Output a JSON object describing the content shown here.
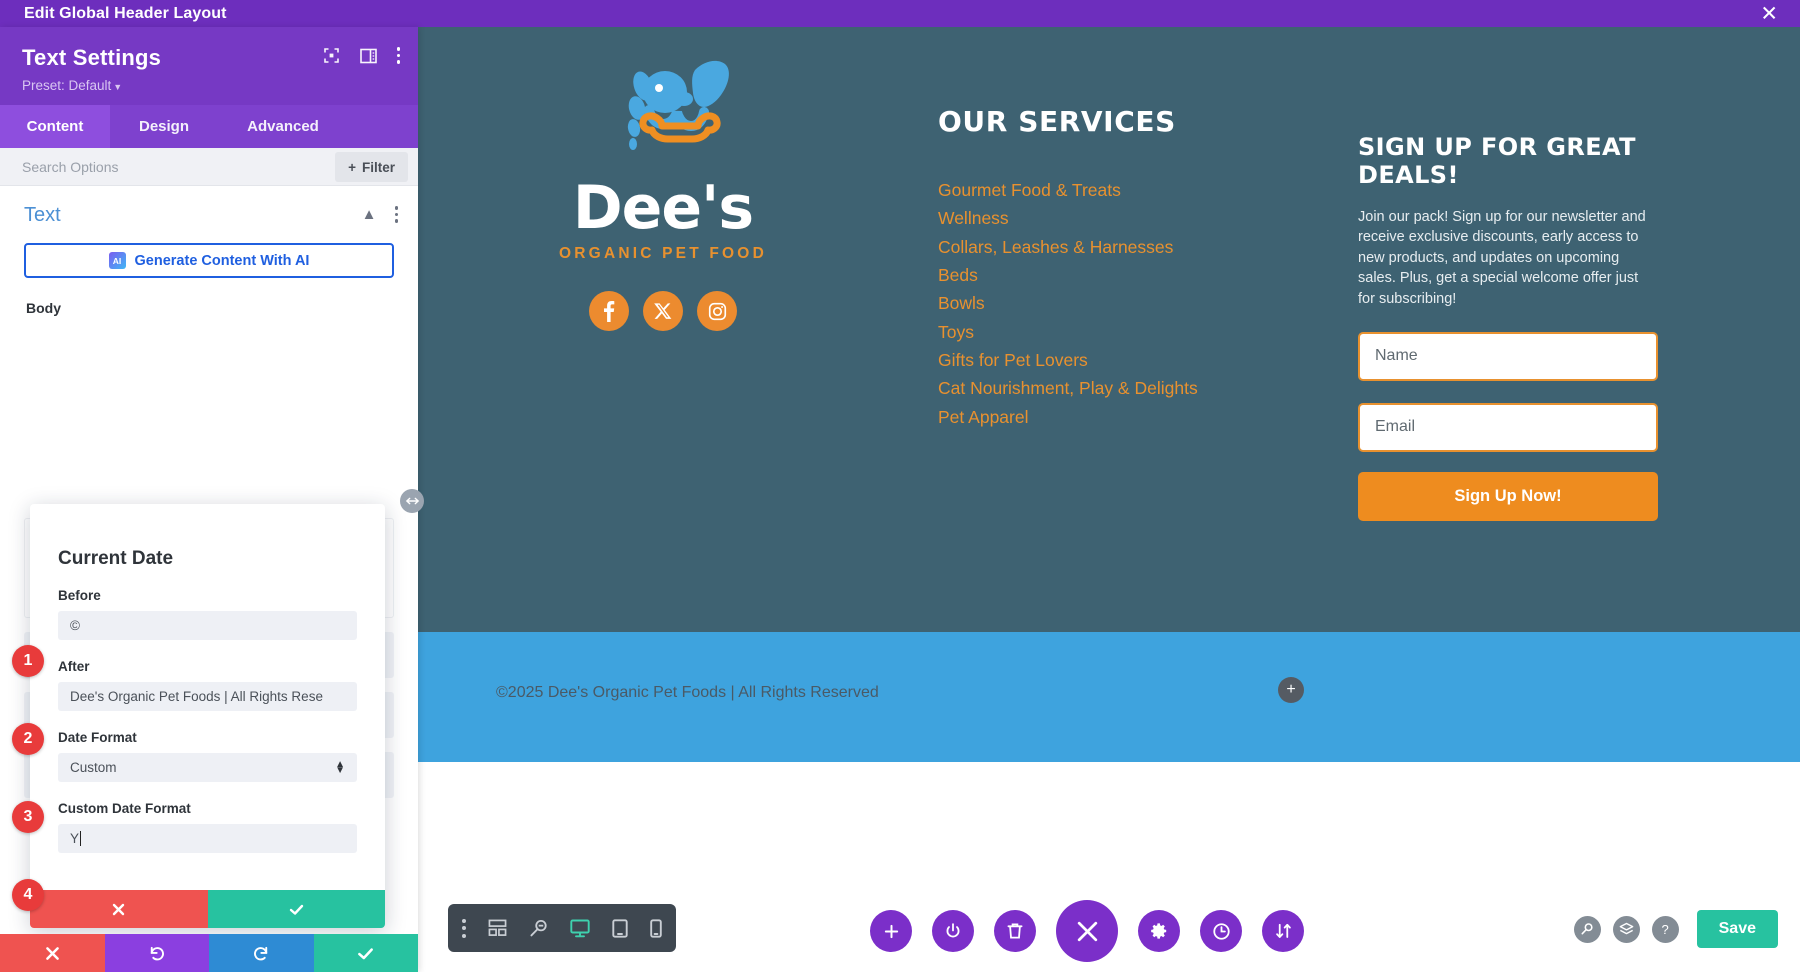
{
  "titlebar": {
    "title": "Edit Global Header Layout",
    "close_icon": "close-icon"
  },
  "panel": {
    "heading": "Text Settings",
    "preset": "Preset: Default",
    "header_icons": [
      "focus-target-icon",
      "panel-layout-icon",
      "kebab-menu-icon"
    ],
    "tabs": [
      {
        "label": "Content",
        "active": true
      },
      {
        "label": "Design",
        "active": false
      },
      {
        "label": "Advanced",
        "active": false
      }
    ],
    "search_placeholder": "Search Options",
    "filter_label": "Filter",
    "section": {
      "title": "Text",
      "collapse_icon": "chevron-up-icon",
      "menu_icon": "kebab-menu-icon"
    },
    "ai_button": {
      "label": "Generate Content With AI",
      "badge": "AI"
    },
    "body_label": "Body",
    "popup": {
      "title": "Current Date",
      "fields": [
        {
          "marker": "1",
          "label": "Before",
          "value": "©"
        },
        {
          "marker": "2",
          "label": "After",
          "value": "Dee's Organic Pet Foods | All Rights Rese"
        },
        {
          "marker": "3",
          "label": "Date Format",
          "value": "Custom",
          "type": "select"
        },
        {
          "marker": "4",
          "label": "Custom Date Format",
          "value": "Y",
          "focused": true
        }
      ],
      "cancel_icon": "close-icon",
      "confirm_icon": "check-icon"
    },
    "footer_actions": [
      {
        "name": "discard-button",
        "icon": "close-icon",
        "color": "#ef5350"
      },
      {
        "name": "undo-button",
        "icon": "undo-icon",
        "color": "#8b3fe0"
      },
      {
        "name": "redo-button",
        "icon": "redo-icon",
        "color": "#2e8bd4"
      },
      {
        "name": "save-button",
        "icon": "check-icon",
        "color": "#27c2a0"
      }
    ],
    "drag_handle_icon": "horizontal-resize-icon"
  },
  "site": {
    "logo": {
      "name": "Dee's",
      "tagline": "ORGANIC PET FOOD"
    },
    "socials": [
      {
        "name": "facebook-icon",
        "label": "Facebook"
      },
      {
        "name": "x-twitter-icon",
        "label": "X"
      },
      {
        "name": "instagram-icon",
        "label": "Instagram"
      }
    ],
    "services": {
      "title": "OUR SERVICES",
      "items": [
        "Gourmet Food & Treats",
        "Wellness",
        "Collars, Leashes & Harnesses",
        "Beds",
        "Bowls",
        "Toys",
        "Gifts for Pet Lovers",
        "Cat Nourishment, Play & Delights",
        "Pet Apparel"
      ]
    },
    "signup": {
      "title": "SIGN UP FOR GREAT DEALS!",
      "body": "Join our pack! Sign up for our newsletter and receive exclusive discounts, early access to new products, and updates on upcoming sales. Plus, get a special welcome offer just for subscribing!",
      "name_placeholder": "Name",
      "email_placeholder": "Email",
      "button_label": "Sign Up Now!"
    },
    "copyright": "©2025 Dee's Organic Pet Foods | All Rights Reserved",
    "add_row_icon": "plus-icon"
  },
  "toolbar": {
    "left": [
      {
        "name": "kebab-menu-icon",
        "active": false
      },
      {
        "name": "wireframe-view-icon",
        "active": false
      },
      {
        "name": "zoom-out-icon",
        "active": false
      },
      {
        "name": "desktop-view-icon",
        "active": true
      },
      {
        "name": "tablet-view-icon",
        "active": false
      },
      {
        "name": "mobile-view-icon",
        "active": false
      }
    ],
    "center": [
      {
        "name": "add-icon",
        "big": false
      },
      {
        "name": "power-icon",
        "big": false
      },
      {
        "name": "trash-icon",
        "big": false
      },
      {
        "name": "close-icon",
        "big": true
      },
      {
        "name": "gear-icon",
        "big": false
      },
      {
        "name": "history-icon",
        "big": false
      },
      {
        "name": "sort-icon",
        "big": false
      }
    ],
    "right_icons": [
      {
        "name": "search-icon",
        "glyph": "⚲"
      },
      {
        "name": "layers-icon",
        "glyph": "⬟"
      },
      {
        "name": "help-icon",
        "glyph": "?"
      }
    ],
    "save_label": "Save"
  },
  "colors": {
    "purple": "#6d2ebd",
    "panel_purple": "#7639c4",
    "accent_blue": "#4c90d4",
    "site_dark": "#3e6272",
    "site_blue": "#3ea3de",
    "orange": "#e8912f",
    "teal": "#27c2a0",
    "red": "#e83b3b"
  }
}
